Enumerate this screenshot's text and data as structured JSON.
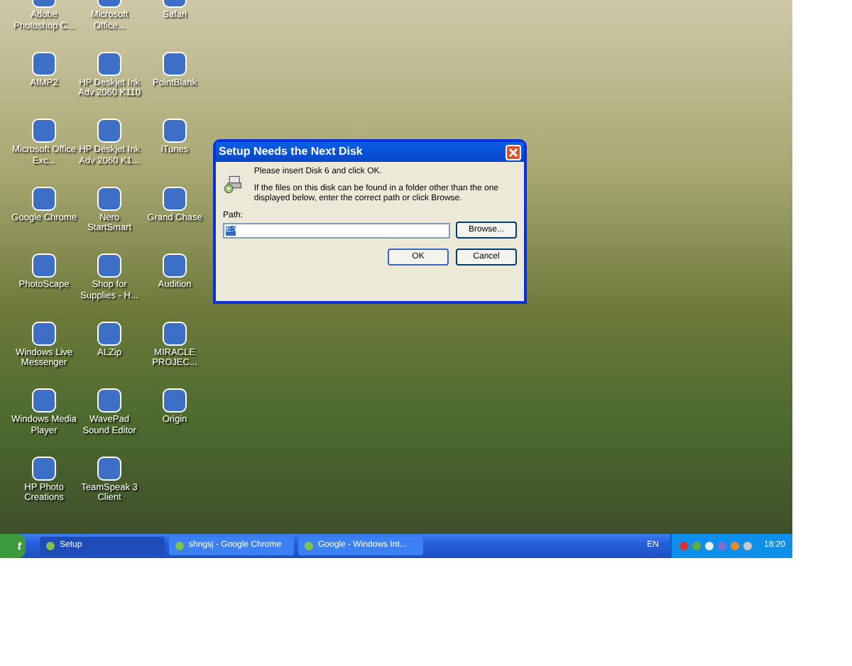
{
  "desktop": {
    "icons": [
      {
        "label": "Adobe Photoshop C..."
      },
      {
        "label": "Microsoft Office..."
      },
      {
        "label": "Safari"
      },
      {
        "label": "AIMP2"
      },
      {
        "label": "HP Deskjet Ink Adv 2060 K110"
      },
      {
        "label": "PointBlank"
      },
      {
        "label": "Microsoft Office Exc..."
      },
      {
        "label": "HP Deskjet Ink Adv 2060 K1..."
      },
      {
        "label": "iTunes"
      },
      {
        "label": "Google Chrome"
      },
      {
        "label": "Nero StartSmart"
      },
      {
        "label": "Grand Chase"
      },
      {
        "label": "PhotoScape"
      },
      {
        "label": "Shop for Supplies - H..."
      },
      {
        "label": "Audition"
      },
      {
        "label": "Windows Live Messenger"
      },
      {
        "label": "ALZip"
      },
      {
        "label": "MIRACLE PROJEC..."
      },
      {
        "label": "Windows Media Player"
      },
      {
        "label": "WavePad Sound Editor"
      },
      {
        "label": "Origin"
      },
      {
        "label": "HP Photo Creations"
      },
      {
        "label": "TeamSpeak 3 Client"
      }
    ]
  },
  "dialog": {
    "title": "Setup Needs the Next Disk",
    "message": "Please insert Disk 6 and click OK.",
    "hint": "If the files on this disk can be found in a folder other than the one displayed below, enter the correct path or click Browse.",
    "path_label": "Path:",
    "path_value": "E:\\",
    "browse": "Browse...",
    "ok": "OK",
    "cancel": "Cancel"
  },
  "taskbar": {
    "start": "t",
    "tasks": [
      {
        "label": "Setup",
        "selected": true
      },
      {
        "label": "shngsj - Google Chrome",
        "selected": false
      },
      {
        "label": "Google - Windows Int...",
        "selected": false
      }
    ],
    "language": "EN",
    "clock": "18:20"
  }
}
